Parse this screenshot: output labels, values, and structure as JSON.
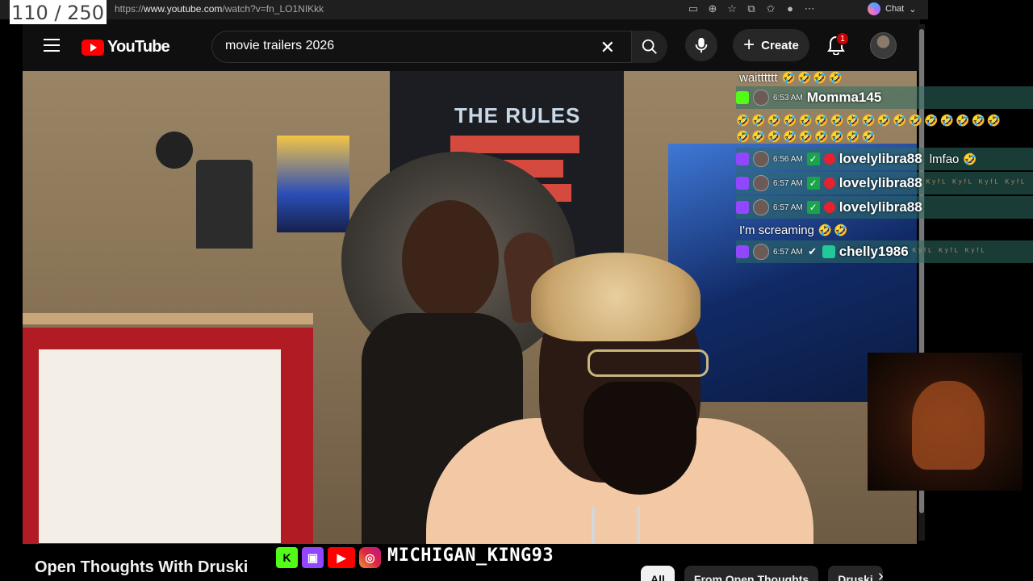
{
  "overlay": {
    "counter": "110 / 250"
  },
  "browser": {
    "url_prefix": "https://",
    "url_domain": "www.youtube.com",
    "url_path": "/watch?v=fn_LO1NIKkk",
    "chat_label": "Chat"
  },
  "header": {
    "logo_text": "YouTube",
    "search": {
      "value": "movie trailers 2026"
    },
    "create_label": "Create",
    "notification_count": "1"
  },
  "chat": {
    "messages": [
      {
        "text": "waitttttt",
        "emotes": "🤣🤣🤣🤣"
      },
      {
        "platform": "kick",
        "time": "6:53 AM",
        "user": "Momma145"
      },
      {
        "emotes_line1": "🤣🤣🤣🤣🤣🤣🤣🤣🤣🤣🤣🤣🤣🤣🤣🤣🤣",
        "emotes_line2": "🤣🤣🤣🤣🤣🤣🤣🤣🤣"
      },
      {
        "platform": "twitch",
        "time": "6:56 AM",
        "user": "lovelylibra88",
        "text": "lmfao",
        "emotes": "🤣"
      },
      {
        "platform": "twitch",
        "time": "6:57 AM",
        "user": "lovelylibra88",
        "emotes": "ᴷʸᶠᴸ ᴷʸᶠᴸ ᴷʸᶠᴸ ᴷʸᶠᴸ"
      },
      {
        "platform": "twitch",
        "time": "6:57 AM",
        "user": "lovelylibra88"
      },
      {
        "text": "I'm screaming",
        "emotes": "🤣🤣"
      },
      {
        "platform": "twitch",
        "time": "6:57 AM",
        "user": "chelly1986",
        "emotes": "ᴷʸᶠᴸ ᴷʸᶠᴸ ᴷʸᶠᴸ"
      }
    ]
  },
  "video": {
    "board_title": "THE RULES",
    "title": "Open Thoughts With Druski"
  },
  "stream": {
    "channel": "MICHIGAN_KING93"
  },
  "chips": [
    "All",
    "From Open Thoughts",
    "Druski"
  ]
}
